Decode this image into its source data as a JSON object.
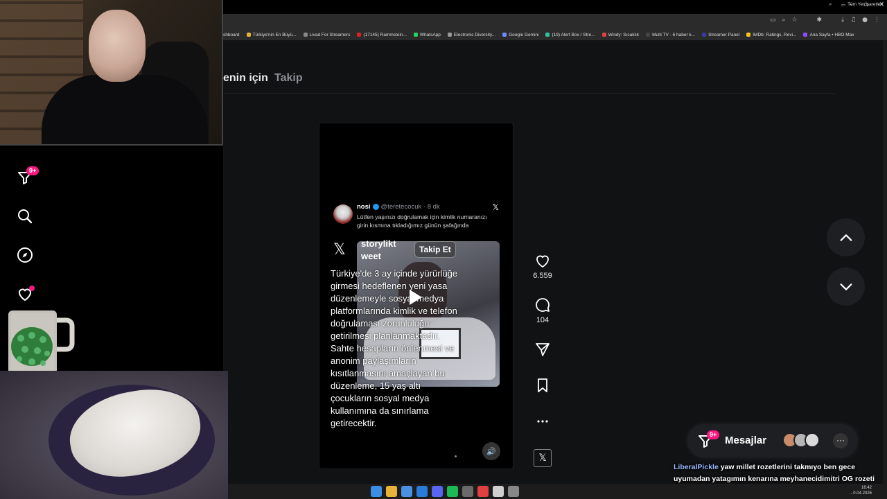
{
  "browser": {
    "window_controls": [
      "–",
      "▫",
      "✕"
    ],
    "bookmarks": [
      {
        "label": "shboard",
        "color": "#4a4a4a"
      },
      {
        "label": "Türkiye'nin En Büyü...",
        "color": "#e8b23a"
      },
      {
        "label": "Livad For Streamers",
        "color": "#888888"
      },
      {
        "label": "(17145) Rammstein...",
        "color": "#e02020"
      },
      {
        "label": "WhatsApp",
        "color": "#25d366"
      },
      {
        "label": "Electronic Diversity...",
        "color": "#999999"
      },
      {
        "label": "Google Gemini",
        "color": "#6b8cff"
      },
      {
        "label": "(19) Alert Box / Stre...",
        "color": "#30c0a0"
      },
      {
        "label": "Windy: Sıcaklık",
        "color": "#e04040"
      },
      {
        "label": "Multi TV - 6 haber k...",
        "color": "#444444"
      },
      {
        "label": "Streamer Panel",
        "color": "#3a3aa0"
      },
      {
        "label": "IMDb: Ratings, Revi...",
        "color": "#f5c518"
      },
      {
        "label": "Ana Sayfa • HBO Max",
        "color": "#8a4dff"
      }
    ],
    "bookmarks_more": "»",
    "all_bookmarks": "Tüm Yer İşaretleri"
  },
  "tabs": {
    "for_you": "enin için",
    "following": "Takip"
  },
  "sidebar": {
    "notifications_badge": "9+"
  },
  "video": {
    "tweet": {
      "name": "nosi",
      "handle": "@teretecocuk · 8 dk",
      "text": "Lütfen yaşınızı doğrulamak için kimlik numaranızı girin kısmına tıkladığımız günün şafağında"
    },
    "x_logo": "𝕏",
    "x_small": "𝕏",
    "storylikt": "storylikt\nweet",
    "follow_button": "Takip Et",
    "overlay_text": "Türkiye'de 3 ay içinde yürürlüğe girmesi hedeflenen yeni yasa düzenlemeyle sosyal medya platformlarında kimlik ve telefon doğrulaması zorunluluğu getirilmesi planlanmaktadır. Sahte hesapların önlenmesi ve anonim paylaşımların kısıtlanmasını amaçlayan bu düzenleme, 15 yaş altı çocukların sosyal medya kullanımına da sınırlama getirecektir.",
    "volume_icon": "🔊"
  },
  "actions": {
    "likes": "6.559",
    "comments": "104",
    "x_button": "𝕏"
  },
  "messages": {
    "label": "Mesajlar",
    "badge": "9+",
    "more": "···",
    "avatar_colors": [
      "#c98b6a",
      "#b5b5b5",
      "#d9d9d9"
    ]
  },
  "chat": {
    "user": "LiberalPickle",
    "message": "yaw millet rozetlerini takmıyo ben gece uyumadan yatagımın kenarına meyhanecidimitri OG rozeti yazıyorum"
  },
  "taskbar": {
    "time": "16:42",
    "date": "…0.04.2026",
    "icon_colors": [
      "#3a8ee6",
      "#e8b23a",
      "#4a90e2",
      "#2a7ad9",
      "#5865f2",
      "#1db954",
      "#6a6a6a",
      "#e04040",
      "#d0d0d0",
      "#888888"
    ]
  },
  "colors": {
    "accent_pink": "#f91880",
    "verified_blue": "#1d9bf0",
    "background": "#111214"
  }
}
